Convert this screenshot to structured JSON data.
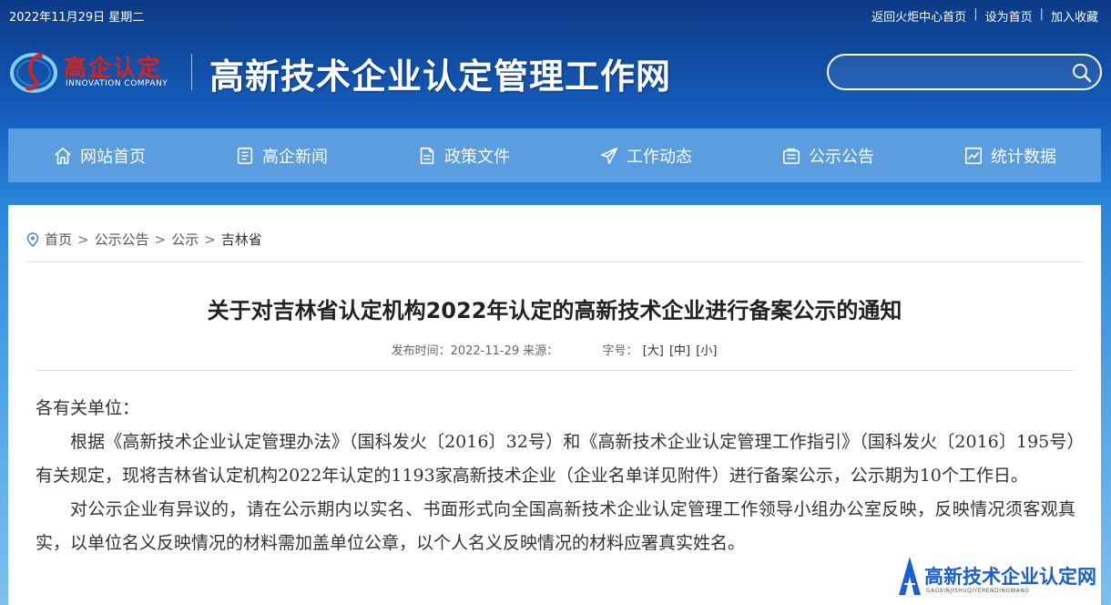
{
  "topbar": {
    "date": "2022年11月29日 星期二",
    "links": [
      "返回火炬中心首页",
      "设为首页",
      "加入收藏"
    ]
  },
  "header": {
    "logo_name": "高企认定",
    "logo_sub": "INNOVATION COMPANY",
    "site_title": "高新技术企业认定管理工作网",
    "search_placeholder": ""
  },
  "nav": [
    {
      "label": "网站首页",
      "icon": "home-icon"
    },
    {
      "label": "高企新闻",
      "icon": "news-icon"
    },
    {
      "label": "政策文件",
      "icon": "document-icon"
    },
    {
      "label": "工作动态",
      "icon": "paper-plane-icon"
    },
    {
      "label": "公示公告",
      "icon": "bulletin-icon"
    },
    {
      "label": "统计数据",
      "icon": "chart-icon"
    }
  ],
  "breadcrumb": [
    "首页",
    "公示公告",
    "公示",
    "吉林省"
  ],
  "article": {
    "title": "关于对吉林省认定机构2022年认定的高新技术企业进行备案公示的通知",
    "meta_publish": "发布时间：2022-11-29 来源：",
    "meta_font_label": "字号：",
    "font_sizes": [
      "[大]",
      "[中]",
      "[小]"
    ],
    "paragraphs": [
      "各有关单位：",
      "根据《高新技术企业认定管理办法》（国科发火〔2016〕32号）和《高新技术企业认定管理工作指引》（国科发火〔2016〕195号）有关规定，现将吉林省认定机构2022年认定的1193家高新技术企业（企业名单详见附件）进行备案公示，公示期为10个工作日。",
      "对公示企业有异议的，请在公示期内以实名、书面形式向全国高新技术企业认定管理工作领导小组办公室反映，反映情况须客观真实，以单位名义反映情况的材料需加盖单位公章，以个人名义反映情况的材料应署真实姓名。"
    ]
  },
  "watermark": {
    "title": "高新技术企业认定网",
    "sub": "GAOXINJISHUQIYERENDINGWANG"
  },
  "colors": {
    "nav_bg": "#5a9ee0",
    "logo_red": "#d4241f",
    "header_dark": "#0c3a86"
  }
}
